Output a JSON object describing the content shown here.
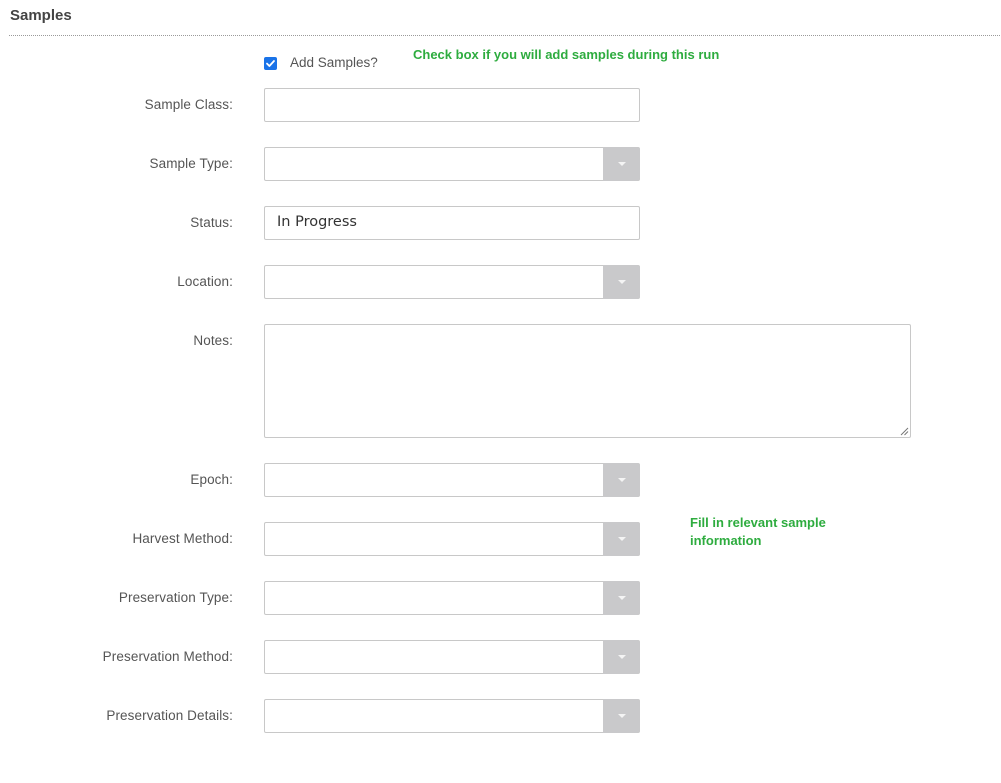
{
  "section": {
    "title": "Samples"
  },
  "add_samples": {
    "label": "Add Samples?",
    "checked": true,
    "hint": "Check box if you will add samples during this run"
  },
  "fields": {
    "sample_class": {
      "label": "Sample Class:",
      "value": ""
    },
    "sample_type": {
      "label": "Sample Type:",
      "value": ""
    },
    "status": {
      "label": "Status:",
      "value": "In Progress"
    },
    "location": {
      "label": "Location:",
      "value": ""
    },
    "notes": {
      "label": "Notes:",
      "value": ""
    },
    "epoch": {
      "label": "Epoch:",
      "value": ""
    },
    "harvest_method": {
      "label": "Harvest Method:",
      "value": ""
    },
    "preservation_type": {
      "label": "Preservation Type:",
      "value": ""
    },
    "preservation_method": {
      "label": "Preservation Method:",
      "value": ""
    },
    "preservation_details": {
      "label": "Preservation Details:",
      "value": ""
    }
  },
  "hints": {
    "fill_in": "Fill in relevant sample information"
  },
  "colors": {
    "hint_green": "#2eac3f",
    "checkbox_blue": "#1a73e8",
    "dropdown_button": "#c9c9cb"
  }
}
